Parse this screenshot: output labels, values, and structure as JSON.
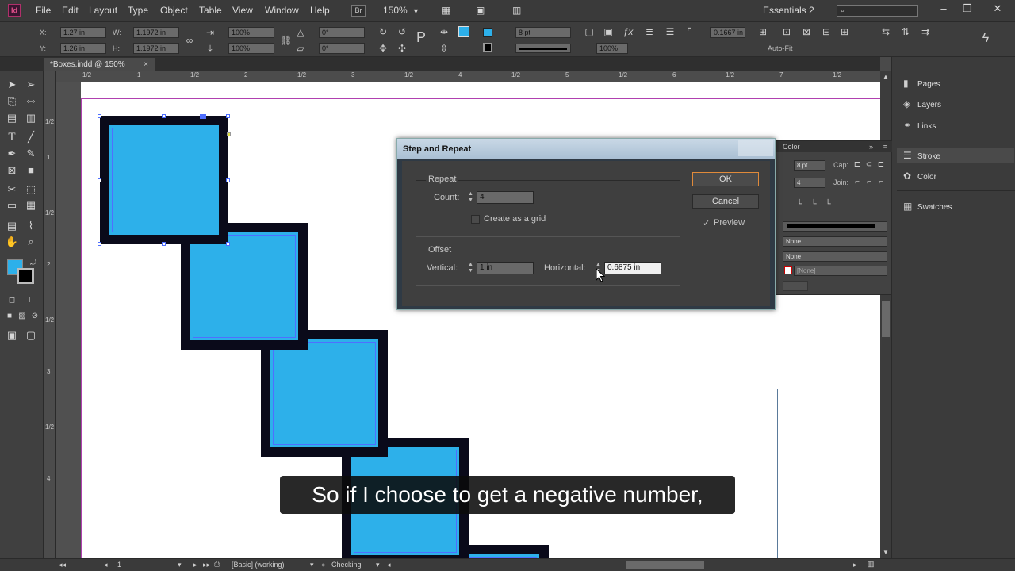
{
  "app": {
    "logo": "Id",
    "menu": [
      "File",
      "Edit",
      "Layout",
      "Type",
      "Object",
      "Table",
      "View",
      "Window",
      "Help"
    ],
    "br_label": "Br",
    "zoom": "150%",
    "workspace": "Essentials 2",
    "search_placeholder": ""
  },
  "control": {
    "x_label": "X:",
    "x_value": "1.27 in",
    "y_label": "Y:",
    "y_value": "1.26 in",
    "w_label": "W:",
    "w_value": "1.1972 in",
    "h_label": "H:",
    "h_value": "1.1972 in",
    "scale_x": "100%",
    "scale_y": "100%",
    "rotate": "0°",
    "shear": "0°",
    "stroke_weight": "8 pt",
    "opacity": "100%",
    "corner": "0.1667 in",
    "autofit": "Auto-Fit"
  },
  "tab": {
    "title": "*Boxes.indd @ 150%",
    "close": "×"
  },
  "ruler_h": [
    "1/2",
    "1",
    "1/2",
    "2",
    "1/2",
    "3",
    "1/2",
    "4",
    "1/2",
    "5",
    "1/2",
    "6",
    "1/2",
    "7",
    "1/2"
  ],
  "ruler_v": [
    "1/2",
    "1",
    "1/2",
    "2",
    "1/2",
    "3",
    "1/2",
    "4"
  ],
  "dock": {
    "pages": "Pages",
    "layers": "Layers",
    "links": "Links",
    "stroke": "Stroke",
    "color": "Color",
    "swatches": "Swatches"
  },
  "stroke_panel": {
    "tab_label": "Color",
    "weight": "8 pt",
    "cap_label": "Cap:",
    "miter": "4",
    "join_label": "Join:",
    "start_none": "None",
    "end_none": "None",
    "gap_color": "[None]"
  },
  "dialog": {
    "title": "Step and Repeat",
    "repeat_label": "Repeat",
    "count_label": "Count:",
    "count_value": "4",
    "grid_label": "Create as a grid",
    "offset_label": "Offset",
    "vertical_label": "Vertical:",
    "vertical_value": "1 in",
    "horizontal_label": "Horizontal:",
    "horizontal_value": "0.6875 in",
    "ok": "OK",
    "cancel": "Cancel",
    "preview_label": "Preview",
    "preview_check": "✓"
  },
  "status": {
    "page": "1",
    "style": "[Basic] (working)",
    "preflight": "Checking"
  },
  "subtitle": "So if I choose to get a negative number,",
  "colors": {
    "box_fill": "#2db0ea",
    "box_stroke": "#0a0a1a",
    "selection": "#4f6fff",
    "margin": "#b040b0"
  }
}
